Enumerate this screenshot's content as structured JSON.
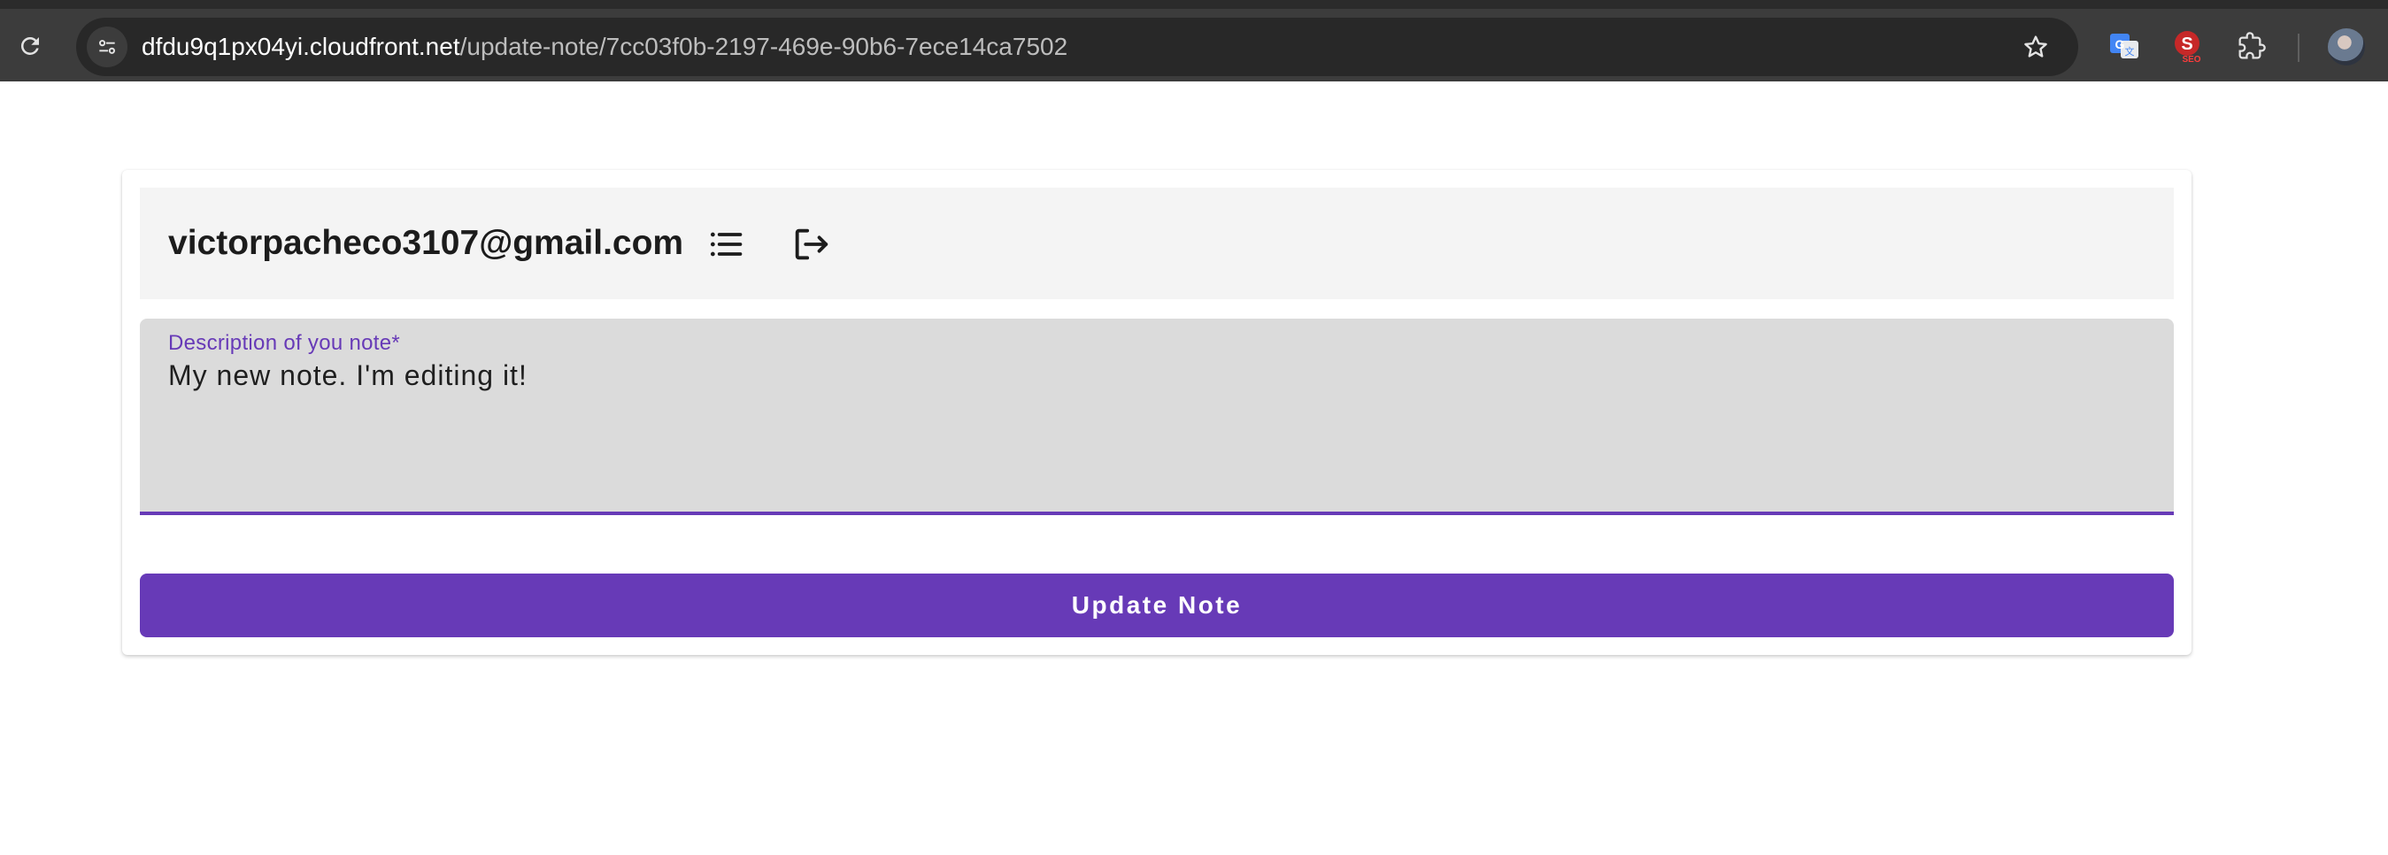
{
  "browser": {
    "url_host": "dfdu9q1px04yi.cloudfront.net",
    "url_path": "/update-note/7cc03f0b-2197-469e-90b6-7ece14ca7502",
    "icons": [
      "reload-icon",
      "site-info-icon",
      "bookmark-star-icon",
      "google-translate-icon",
      "seo-extension-icon",
      "extensions-puzzle-icon",
      "profile-avatar"
    ],
    "seo_badge": "SEO"
  },
  "header": {
    "user_email": "victorpacheco3107@gmail.com",
    "icons": [
      "list-icon",
      "logout-icon"
    ]
  },
  "form": {
    "description_label": "Description of you note*",
    "description_value": "My new note. I'm editing it!",
    "submit_label": "Update Note"
  },
  "colors": {
    "accent": "#673ab7",
    "header_bg": "#f4f4f4",
    "field_bg": "#dbdbdb",
    "chrome_bg": "#3c3c3c"
  }
}
